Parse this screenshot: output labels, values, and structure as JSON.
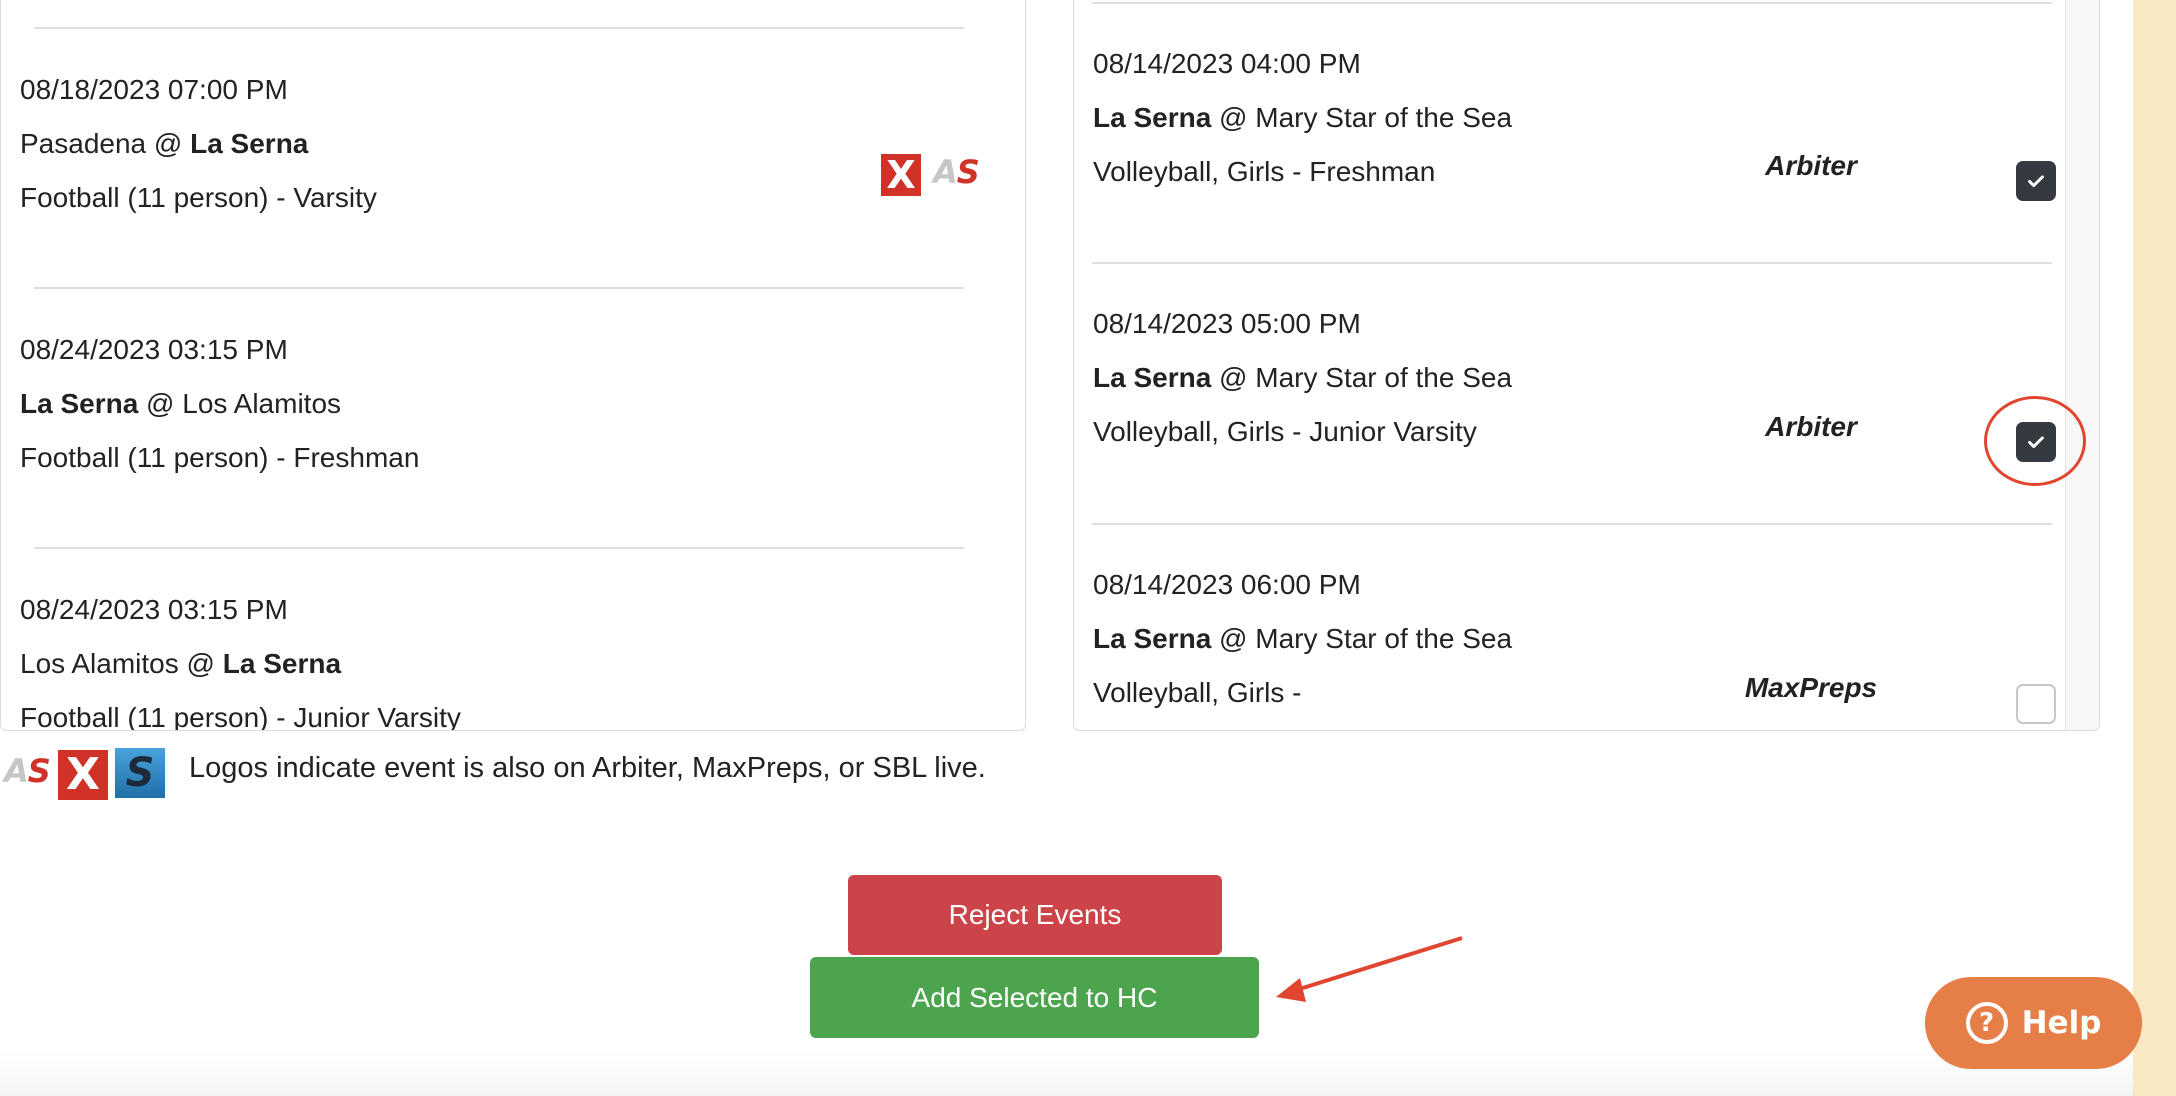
{
  "left_events": [
    {
      "datetime": "08/18/2023 07:00 PM",
      "away": "Pasadena",
      "sep": " @ ",
      "home": "La Serna",
      "sport": "Football (11 person) - Varsity",
      "logos": [
        "maxpreps-logo",
        "arbiter-logo"
      ]
    },
    {
      "datetime": "08/24/2023 03:15 PM",
      "away": "La Serna",
      "sep": " @ ",
      "home": "Los Alamitos",
      "sport": "Football (11 person) - Freshman"
    },
    {
      "datetime": "08/24/2023 03:15 PM",
      "away": "Los Alamitos",
      "sep": " @ ",
      "home": "La Serna",
      "sport": "Football (11 person) - Junior Varsity"
    }
  ],
  "right_events": [
    {
      "datetime": "08/14/2023 04:00 PM",
      "away": "La Serna",
      "sep": " @ ",
      "home": "Mary Star of the Sea",
      "sport": "Volleyball, Girls - Freshman",
      "source": "Arbiter",
      "checked": true
    },
    {
      "datetime": "08/14/2023 05:00 PM",
      "away": "La Serna",
      "sep": " @ ",
      "home": "Mary Star of the Sea",
      "sport": "Volleyball, Girls - Junior Varsity",
      "source": "Arbiter",
      "checked": true
    },
    {
      "datetime": "08/14/2023 06:00 PM",
      "away": "La Serna",
      "sep": " @ ",
      "home": "Mary Star of the Sea",
      "sport": "Volleyball, Girls -",
      "source": "MaxPreps",
      "checked": false
    }
  ],
  "logos": {
    "x_glyph": "X",
    "as_a": "A",
    "as_s": "S",
    "sbl_glyph": "S"
  },
  "legend": {
    "text": "Logos indicate event is also on Arbiter, MaxPreps, or SBL live."
  },
  "buttons": {
    "reject_label": "Reject Events",
    "add_label": "Add Selected to HC"
  },
  "help": {
    "label": "Help",
    "icon": "?"
  },
  "colors": {
    "reject": "#cc434a",
    "add": "#4ca54e",
    "help": "#e57e47",
    "checkbox_checked": "#343a40",
    "annotation": "#e0462f",
    "side_strip": "#f8e9c3"
  }
}
